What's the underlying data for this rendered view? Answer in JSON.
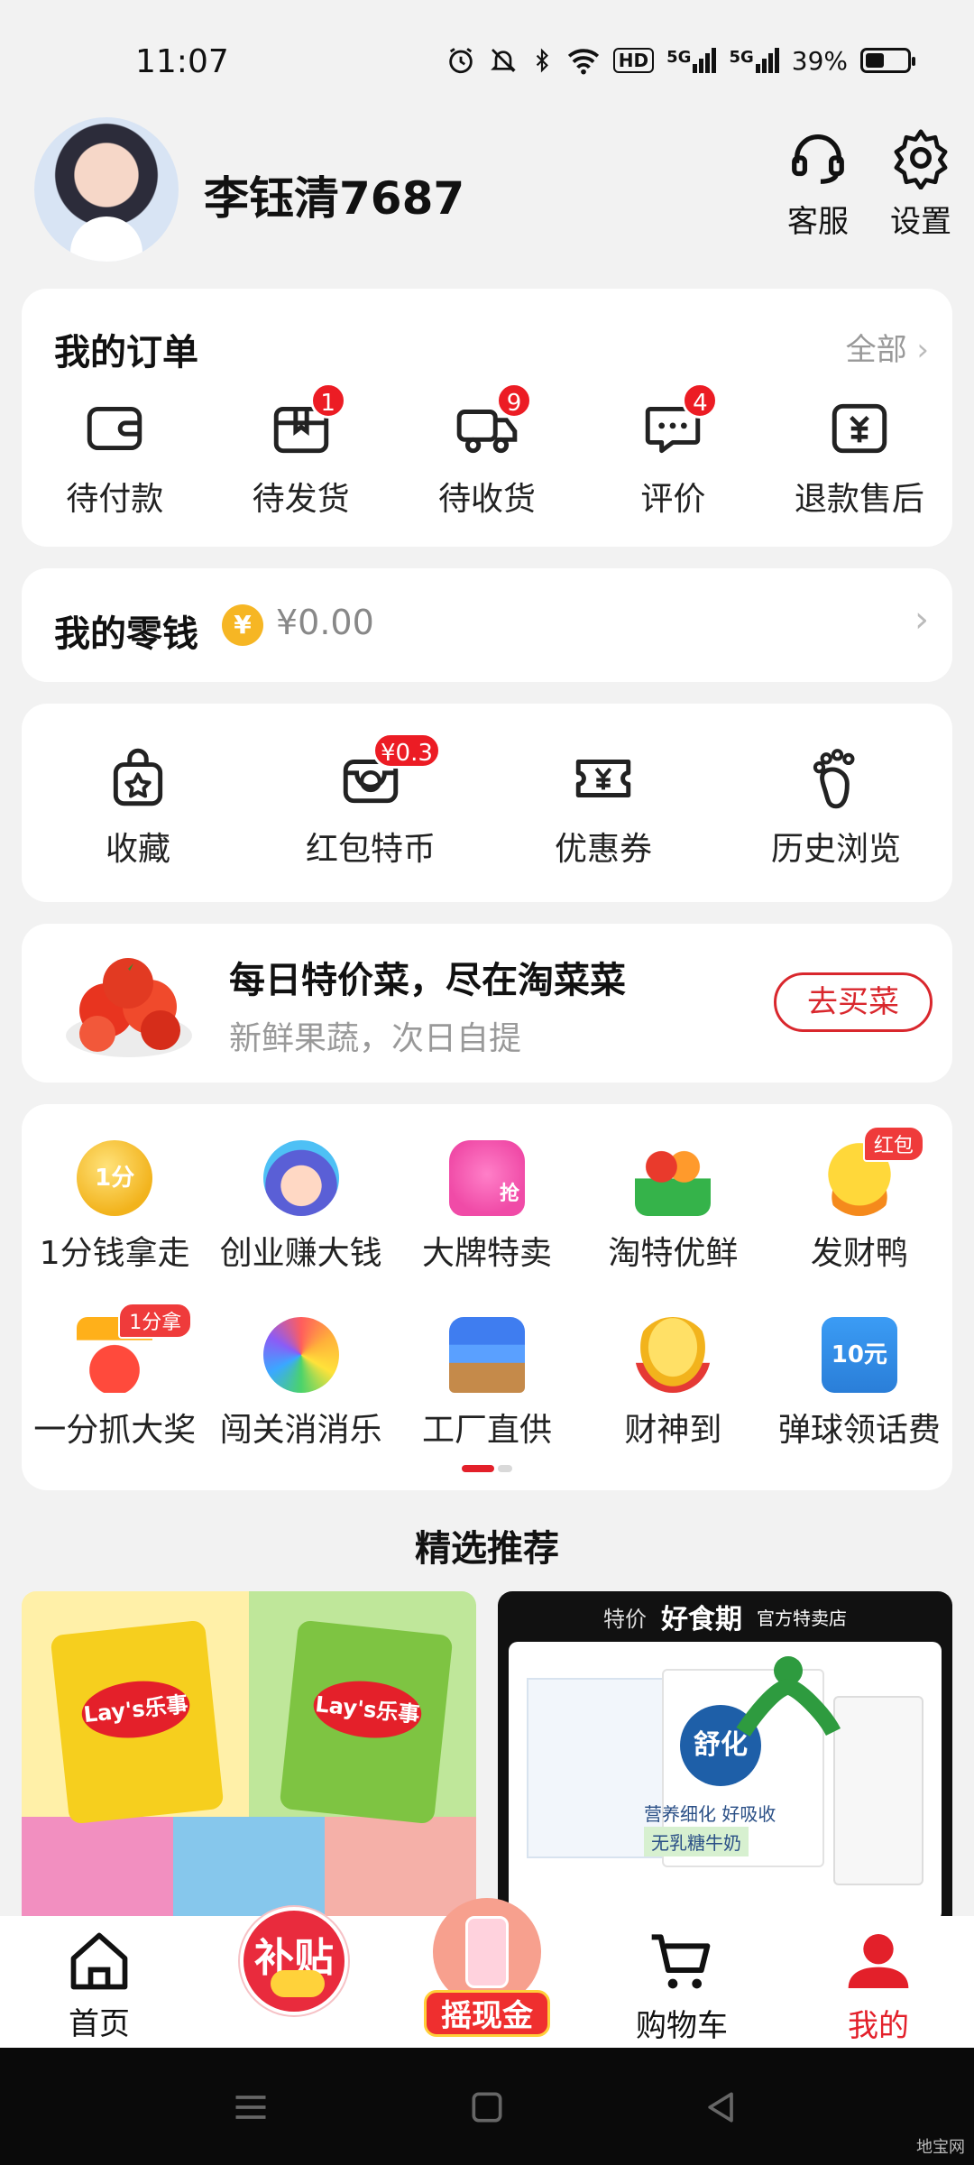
{
  "status": {
    "time": "11:07",
    "battery": "39%",
    "network_1": "5G",
    "network_2": "5G",
    "hd": "HD"
  },
  "profile": {
    "username": "李钰清7687",
    "service_label": "客服",
    "settings_label": "设置"
  },
  "orders": {
    "title": "我的订单",
    "all_label": "全部",
    "items": [
      {
        "label": "待付款",
        "icon": "wallet-icon",
        "badge": ""
      },
      {
        "label": "待发货",
        "icon": "package-icon",
        "badge": "1"
      },
      {
        "label": "待收货",
        "icon": "truck-icon",
        "badge": "9"
      },
      {
        "label": "评价",
        "icon": "comment-icon",
        "badge": "4"
      },
      {
        "label": "退款售后",
        "icon": "refund-icon",
        "badge": ""
      }
    ]
  },
  "wallet": {
    "title": "我的零钱",
    "coin_symbol": "¥",
    "amount": "¥0.00"
  },
  "tools": {
    "items": [
      {
        "label": "收藏",
        "icon": "favorite-bag-icon",
        "badge": ""
      },
      {
        "label": "红包特币",
        "icon": "coin-box-icon",
        "badge": "¥0.3"
      },
      {
        "label": "优惠券",
        "icon": "coupon-icon",
        "badge": ""
      },
      {
        "label": "历史浏览",
        "icon": "footprint-icon",
        "badge": ""
      }
    ]
  },
  "grocery": {
    "title": "每日特价菜，尽在淘菜菜",
    "subtitle": "新鲜果蔬，次日自提",
    "button": "去买菜"
  },
  "services": {
    "row1": [
      {
        "label": "1分钱拿走",
        "icon": "gold-coin-icon",
        "tag": "",
        "glyph": "1分"
      },
      {
        "label": "创业赚大钱",
        "icon": "avatar-girl-icon",
        "tag": "",
        "glyph": ""
      },
      {
        "label": "大牌特卖",
        "icon": "tshirt-icon",
        "tag": "",
        "glyph": "抢"
      },
      {
        "label": "淘特优鲜",
        "icon": "fruit-basket-icon",
        "tag": "",
        "glyph": ""
      },
      {
        "label": "发财鸭",
        "icon": "duck-icon",
        "tag": "红包",
        "glyph": ""
      }
    ],
    "row2": [
      {
        "label": "一分抓大奖",
        "icon": "claw-machine-icon",
        "tag": "1分拿",
        "glyph": ""
      },
      {
        "label": "闯关消消乐",
        "icon": "colorful-flower-icon",
        "tag": "",
        "glyph": ""
      },
      {
        "label": "工厂直供",
        "icon": "factory-icon",
        "tag": "",
        "glyph": ""
      },
      {
        "label": "财神到",
        "icon": "gold-ingot-icon",
        "tag": "",
        "glyph": ""
      },
      {
        "label": "弹球领话费",
        "icon": "phone-credit-icon",
        "tag": "",
        "glyph": "10元"
      }
    ]
  },
  "recommend": {
    "title": "精选推荐",
    "left_brand": "Lay's乐事",
    "right_header": [
      "特价",
      "好食期",
      "官方特卖店"
    ],
    "right_brand": "舒化",
    "right_lines": [
      "营养细化 好吸收",
      "无乳糖牛奶"
    ]
  },
  "tabbar": {
    "items": [
      {
        "label": "首页",
        "icon": "home-icon"
      },
      {
        "label": "补贴",
        "icon": "subsidy-icon"
      },
      {
        "label": "摇现金",
        "icon": "shake-cash-icon"
      },
      {
        "label": "购物车",
        "icon": "cart-icon"
      },
      {
        "label": "我的",
        "icon": "me-icon"
      }
    ],
    "active_color": "#e3202a"
  },
  "watermark": "地宝网"
}
